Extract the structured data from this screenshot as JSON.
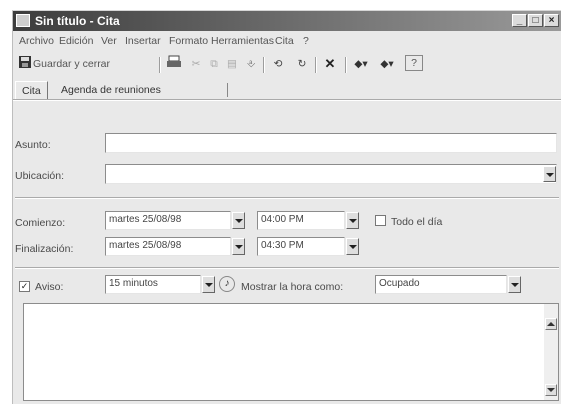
{
  "window": {
    "title": "Sin título - Cita"
  },
  "menu": [
    "Archivo",
    "Edición",
    "Ver",
    "Insertar",
    "Formato",
    "Herramientas",
    "Cita",
    "?"
  ],
  "toolbar": {
    "save_close": "Guardar y cerrar"
  },
  "tabs": [
    "Cita",
    "Agenda de reuniones"
  ],
  "form": {
    "asunto_label": "Asunto:",
    "ubicacion_label": "Ubicación:",
    "comienzo_label": "Comienzo:",
    "comienzo_fecha": "martes 25/08/98",
    "comienzo_hora": "04:00 PM",
    "todo_el_dia_label": "Todo el día",
    "finalizacion_label": "Finalización:",
    "final_fecha": "martes 25/08/98",
    "final_hora": "04:30 PM",
    "aviso_label": "Aviso:",
    "aviso_valor": "15 minutos",
    "mostrar_hora_label": "Mostrar la hora como:",
    "mostrar_hora_valor": "Ocupado"
  }
}
